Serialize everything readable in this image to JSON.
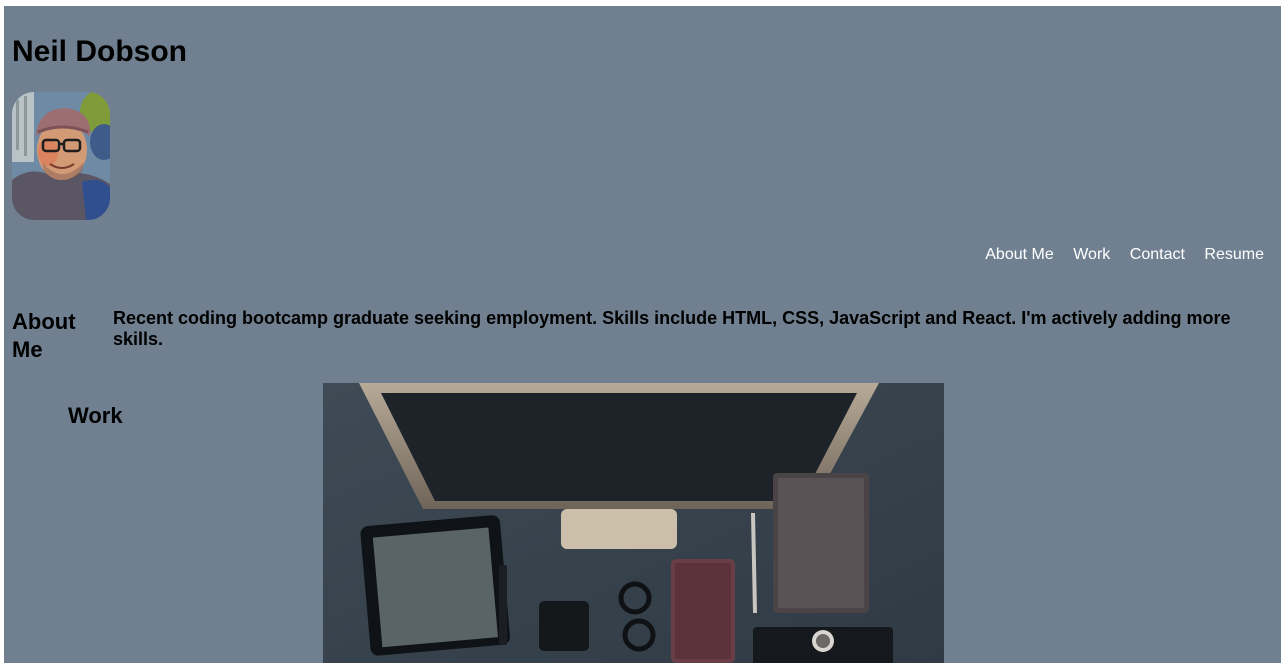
{
  "header": {
    "title": "Neil Dobson",
    "avatar_icon": "profile-photo"
  },
  "nav": {
    "items": [
      {
        "label": "About Me"
      },
      {
        "label": "Work"
      },
      {
        "label": "Contact"
      },
      {
        "label": "Resume"
      }
    ]
  },
  "about": {
    "heading": "About Me",
    "text": "Recent coding bootcamp graduate seeking employment. Skills include HTML, CSS, JavaScript and React. I'm actively adding more skills."
  },
  "work": {
    "heading": "Work",
    "image_icon": "desk-workspace-photo"
  },
  "colors": {
    "page_background": "#708090",
    "nav_text": "#ffffff",
    "heading_text": "#000000"
  }
}
